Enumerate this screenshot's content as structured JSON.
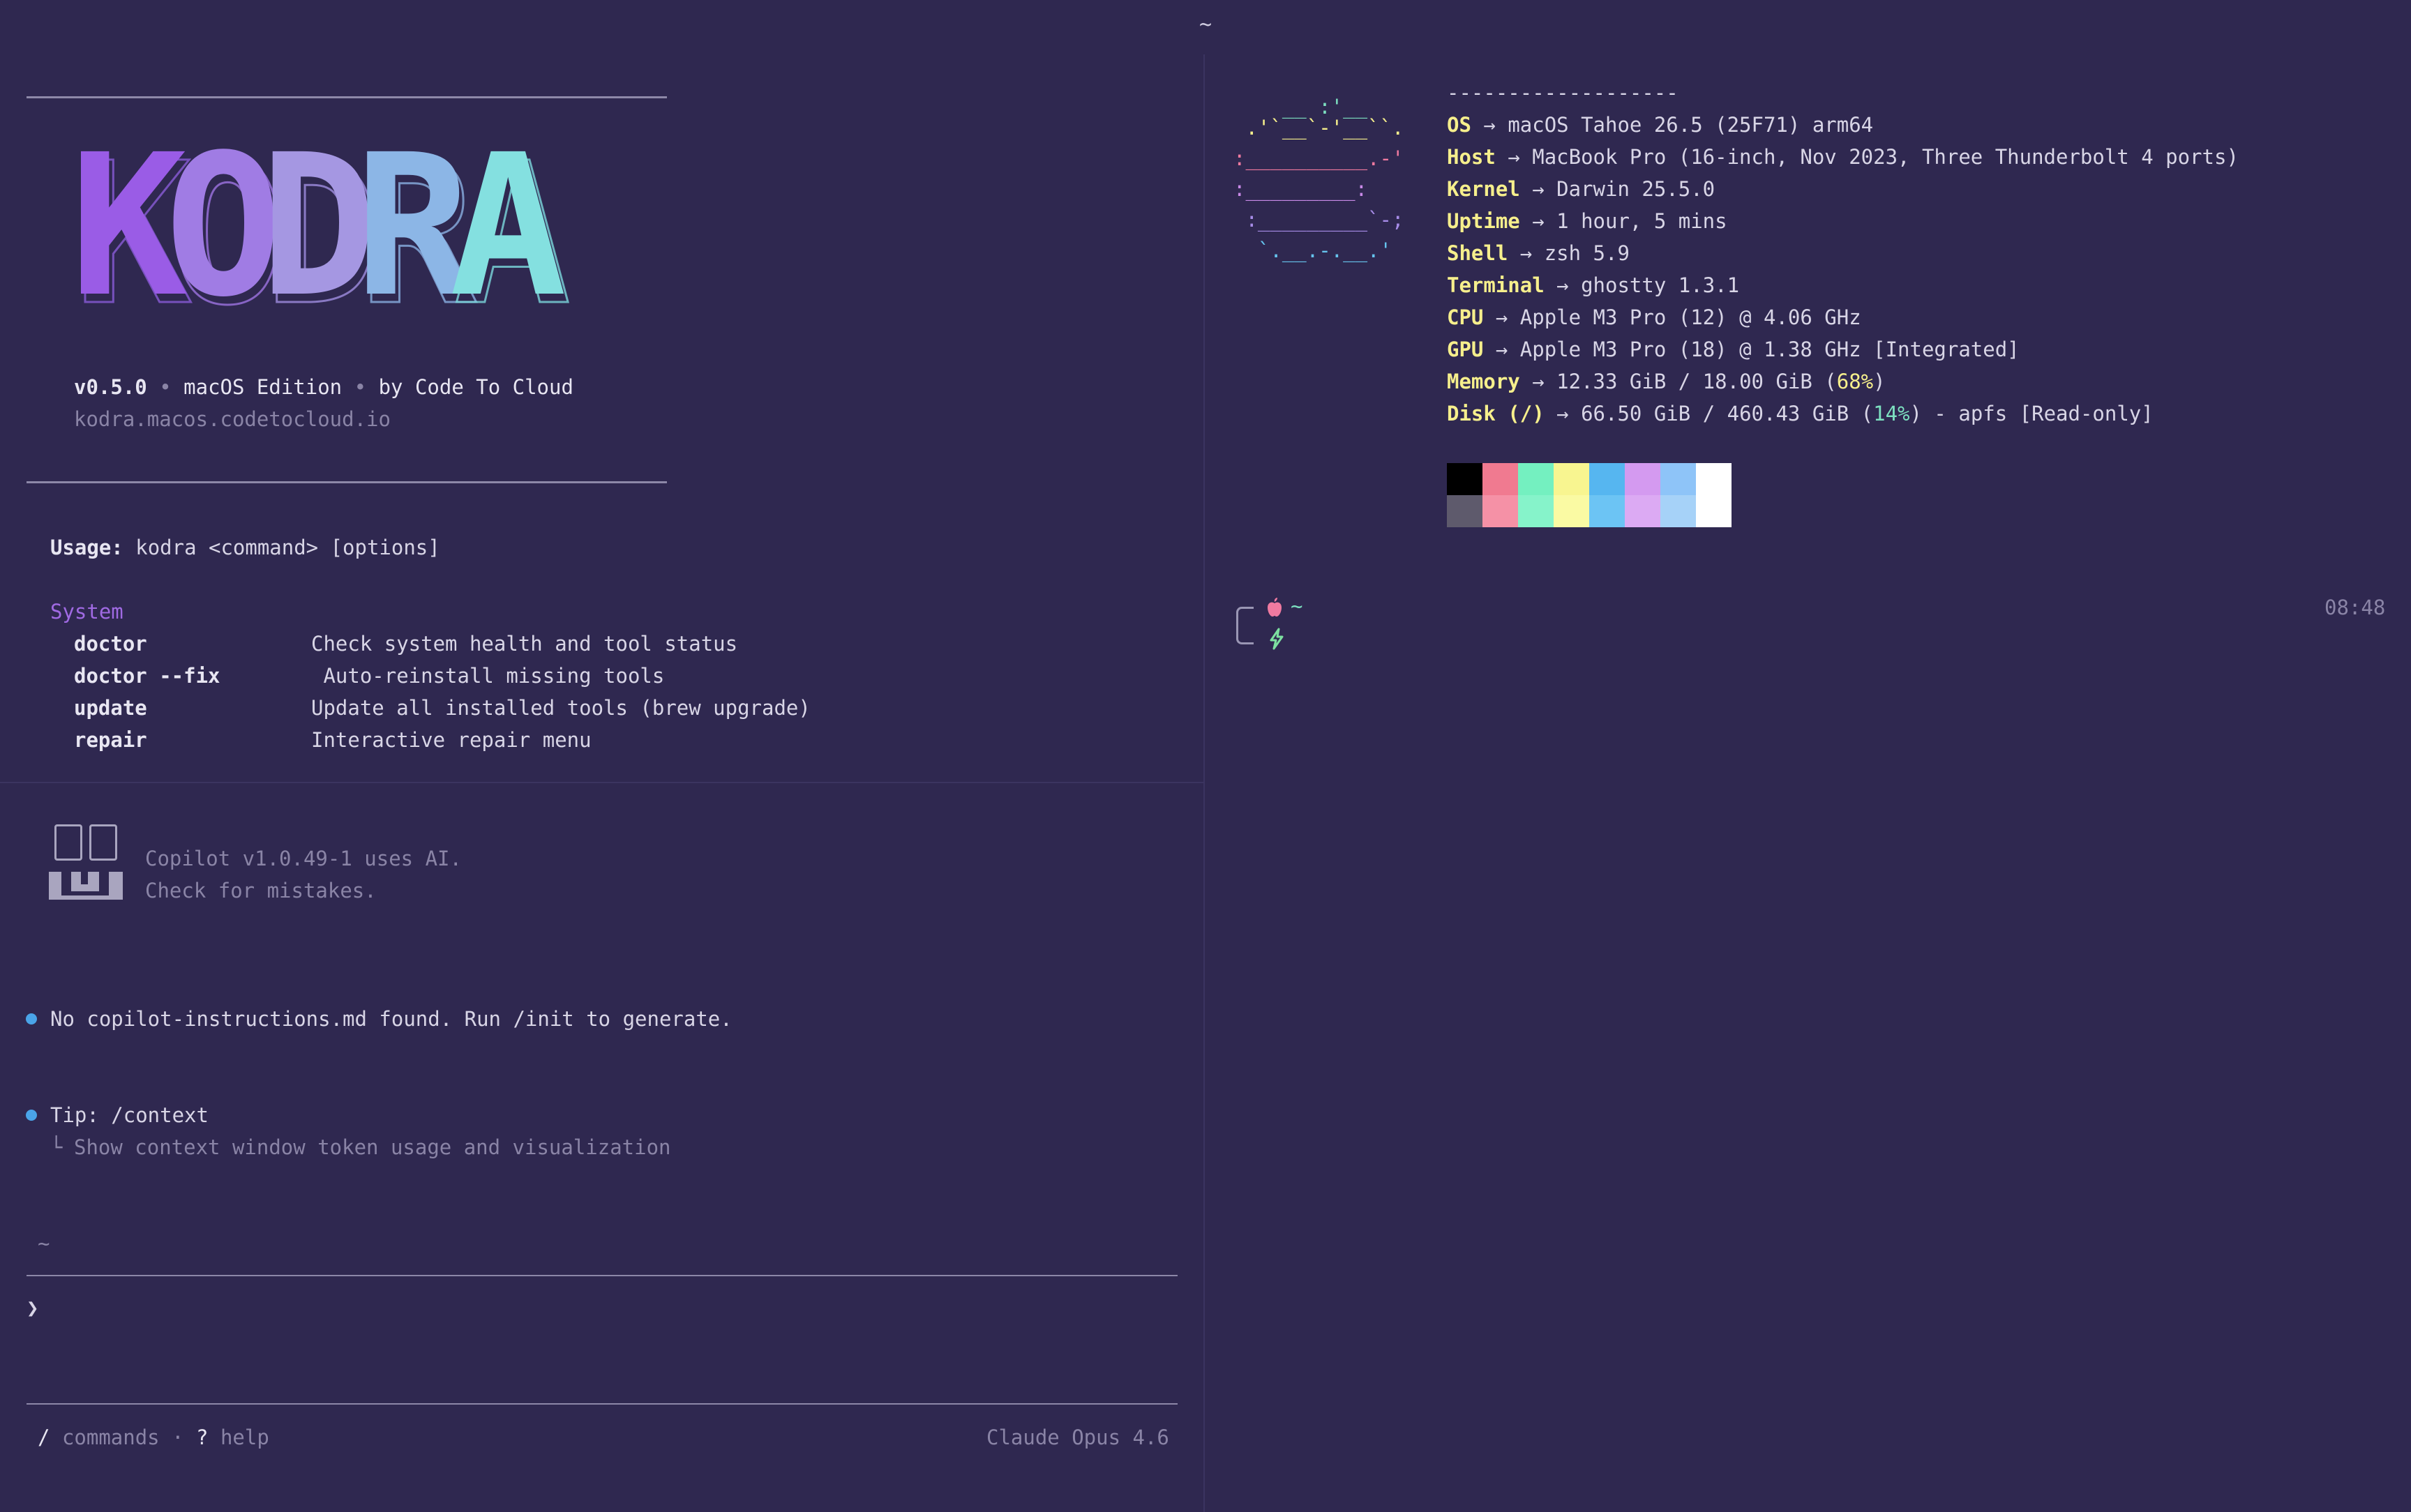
{
  "window": {
    "title": "~"
  },
  "left_pane": {
    "logo": {
      "letters": [
        "K",
        "O",
        "D",
        "R",
        "A"
      ]
    },
    "version_line": {
      "version": "v0.5.0",
      "sep1": "•",
      "edition": "macOS Edition",
      "sep2": "•",
      "byline": "by Code To Cloud"
    },
    "url": "kodra.macos.codetocloud.io",
    "usage": {
      "label": "Usage:",
      "text": "kodra <command> [options]"
    },
    "section_title": "System",
    "commands": [
      {
        "name": "doctor",
        "desc": "Check system health and tool status"
      },
      {
        "name": "doctor --fix",
        "desc": " Auto-reinstall missing tools"
      },
      {
        "name": "update",
        "desc": "Update all installed tools (brew upgrade)"
      },
      {
        "name": "repair",
        "desc": "Interactive repair menu"
      }
    ]
  },
  "copilot_pane": {
    "notice_line1": "Copilot v1.0.49-1 uses AI.",
    "notice_line2": "Check for mistakes.",
    "message1": "No copilot-instructions.md found. Run /init to generate.",
    "tip": "Tip: /context",
    "tip_branch": "└",
    "tip_detail": "Show context window token usage and visualization",
    "cwd": "~",
    "prompt_char": "❯",
    "footer": {
      "slash": "/",
      "commands": "commands",
      "dot": "·",
      "q": "?",
      "help": "help",
      "model": "Claude Opus 4.6"
    }
  },
  "right_pane": {
    "ascii_art": [
      "    __ :'__",
      " .'`__`-'__``.",
      ":__________.-'",
      ":_________:",
      " :_________`-;",
      "  `.__.-.__.'"
    ],
    "separator": "-------------------",
    "info": [
      {
        "key": "OS",
        "arrow": "→",
        "value": "macOS Tahoe 26.5 (25F71) arm64"
      },
      {
        "key": "Host",
        "arrow": "→",
        "value": "MacBook Pro (16-inch, Nov 2023, Three Thunderbolt 4 ports)"
      },
      {
        "key": "Kernel",
        "arrow": "→",
        "value": "Darwin 25.5.0"
      },
      {
        "key": "Uptime",
        "arrow": "→",
        "value": "1 hour, 5 mins"
      },
      {
        "key": "Shell",
        "arrow": "→",
        "value": "zsh 5.9"
      },
      {
        "key": "Terminal",
        "arrow": "→",
        "value": "ghostty 1.3.1"
      },
      {
        "key": "CPU",
        "arrow": "→",
        "value": "Apple M3 Pro (12) @ 4.06 GHz"
      },
      {
        "key": "GPU",
        "arrow": "→",
        "value": "Apple M3 Pro (18) @ 1.38 GHz [Integrated]"
      }
    ],
    "memory": {
      "key": "Memory",
      "arrow": "→",
      "pre": "12.33 GiB / 18.00 GiB (",
      "pct": "68%",
      "post": ")"
    },
    "disk": {
      "key": "Disk (/)",
      "arrow": "→",
      "pre": "66.50 GiB / 460.43 GiB (",
      "pct": "14%",
      "post": ") - apfs [Read-only]"
    },
    "palette_top": [
      "#000000",
      "#f07a90",
      "#74f0c0",
      "#f8f590",
      "#56b6f0",
      "#d49af0",
      "#8ec4f8",
      "#ffffff"
    ],
    "palette_bottom": [
      "#5e5a6c",
      "#f591a6",
      "#86f3ca",
      "#fafaa3",
      "#6cc4f4",
      "#dcaaf3",
      "#a6d2f8",
      "#ffffff"
    ],
    "prompt": {
      "cwd": "~",
      "time": "08:48"
    }
  },
  "colors": {
    "background": "#2f2850",
    "purple": "#a06ae3",
    "yellow": "#f6ef8c",
    "teal": "#7de0c0",
    "bullet": "#4aa4e8"
  },
  "icons": [
    "apple-icon",
    "bolt-icon",
    "copilot-icon"
  ]
}
